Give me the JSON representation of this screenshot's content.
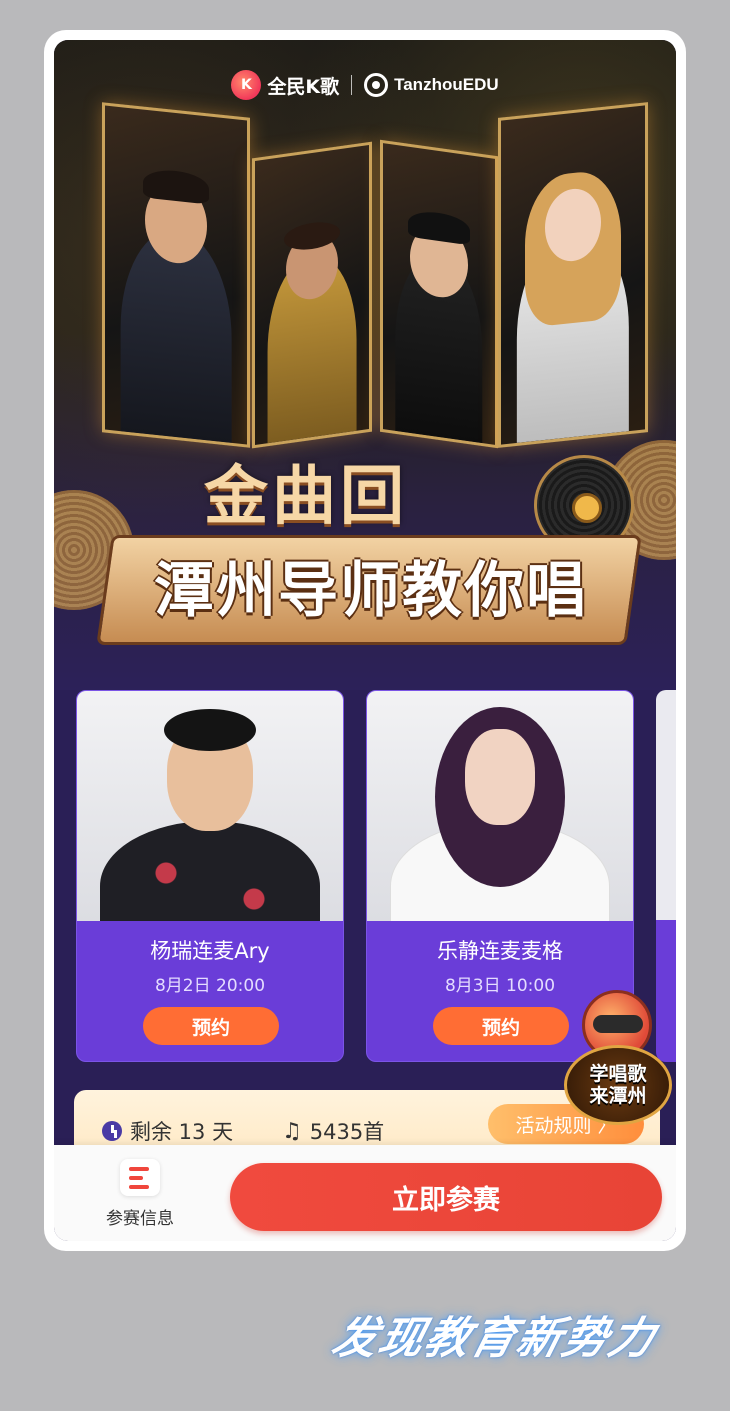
{
  "brand": {
    "karaoke_logo_char": "K",
    "karaoke_name": "全民K歌",
    "partner_name": "TanzhouEDU"
  },
  "hero": {
    "title_line1": "金曲回忆",
    "title_line2": "潭州导师教你唱"
  },
  "cards": [
    {
      "name": "杨瑞连麦Ary",
      "time": "8月2日 20:00",
      "button": "预约"
    },
    {
      "name": "乐静连麦麦格",
      "time": "8月3日 10:00",
      "button": "预约"
    }
  ],
  "badge": {
    "line1": "学唱歌",
    "line2": "来潭州"
  },
  "info": {
    "remaining": "剩余 13 天",
    "songs": "5435首",
    "rules_label": "活动规则",
    "rules_arrow": "〉"
  },
  "bottom": {
    "info_tab_label": "参赛信息",
    "join_label": "立即参赛"
  },
  "watermark": {
    "text": "发现教育新势力"
  },
  "colors": {
    "accent_purple": "#6a3dd8",
    "reserve_orange": "#ff6d34",
    "join_red": "#f04a3e",
    "title_gold": "#f6d7a6"
  },
  "icons": [
    "k-song-logo-icon",
    "tanzhou-logo-icon",
    "clock-icon",
    "music-note-icon",
    "chevron-right-icon",
    "list-icon",
    "vinyl-record-icon"
  ]
}
